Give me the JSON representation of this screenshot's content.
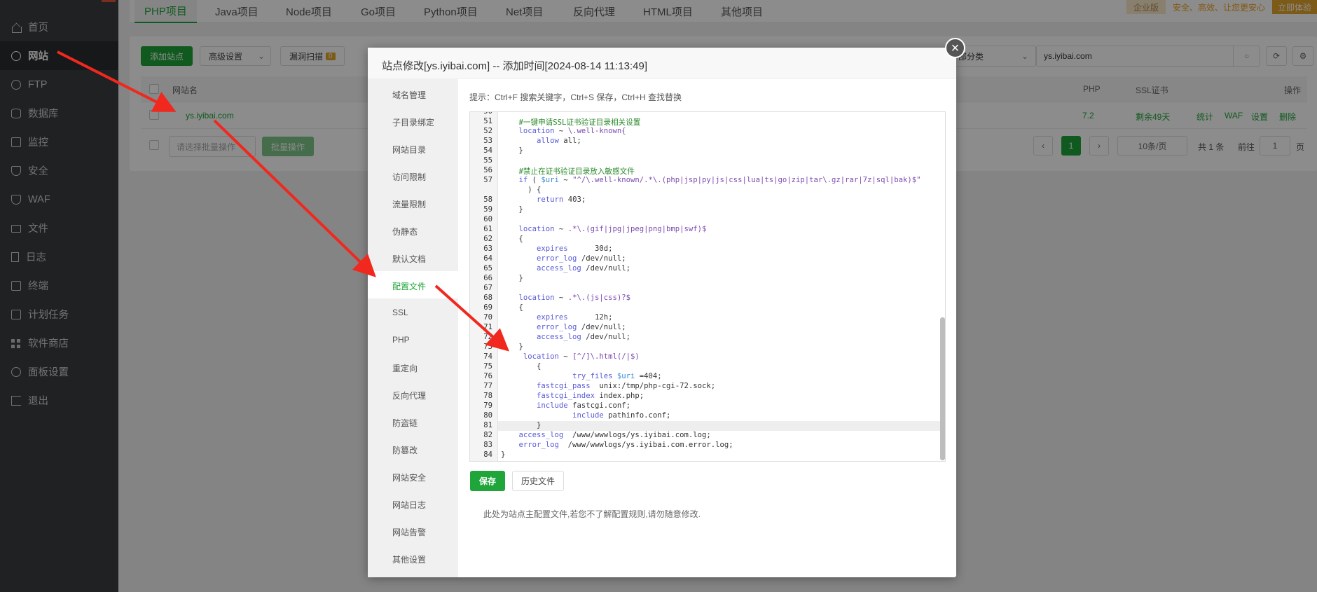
{
  "sidebar": {
    "items": [
      {
        "label": "首页",
        "icon": "home-icon"
      },
      {
        "label": "网站",
        "icon": "globe-icon",
        "active": true
      },
      {
        "label": "FTP",
        "icon": "ftp-icon"
      },
      {
        "label": "数据库",
        "icon": "database-icon"
      },
      {
        "label": "监控",
        "icon": "monitor-icon"
      },
      {
        "label": "安全",
        "icon": "shield-icon"
      },
      {
        "label": "WAF",
        "icon": "waf-icon"
      },
      {
        "label": "文件",
        "icon": "folder-icon"
      },
      {
        "label": "日志",
        "icon": "log-icon"
      },
      {
        "label": "终端",
        "icon": "terminal-icon"
      },
      {
        "label": "计划任务",
        "icon": "calendar-icon"
      },
      {
        "label": "软件商店",
        "icon": "grid-icon"
      },
      {
        "label": "面板设置",
        "icon": "gear-icon"
      },
      {
        "label": "退出",
        "icon": "exit-icon"
      }
    ]
  },
  "project_tabs": [
    "PHP项目",
    "Java项目",
    "Node项目",
    "Go项目",
    "Python项目",
    "Net项目",
    "反向代理",
    "HTML项目",
    "其他项目"
  ],
  "promo": {
    "edition": "企业版",
    "slogan": "安全、高效、让您更安心",
    "cta": "立即体验"
  },
  "toolbar": {
    "add_site": "添加站点",
    "advanced": "高级设置",
    "vuln_scan": "漏洞扫描",
    "vuln_count": "0",
    "category_select": "部分类",
    "search_value": "ys.iyibai.com"
  },
  "table": {
    "headers": {
      "name": "网站名",
      "php": "PHP",
      "ssl": "SSL证书",
      "ops": "操作"
    },
    "row": {
      "name": "ys.iyibai.com",
      "php": "7.2",
      "ssl": "剩余49天",
      "ops": [
        "统计",
        "WAF",
        "设置",
        "删除"
      ]
    },
    "batch_placeholder": "请选择批量操作",
    "batch_button": "批量操作"
  },
  "pagination": {
    "prev": "‹",
    "current": "1",
    "next": "›",
    "per_page": "10条/页",
    "total": "共 1 条",
    "goto_label": "前往",
    "goto_value": "1",
    "page_suffix": "页"
  },
  "modal": {
    "title": "站点修改[ys.iyibai.com] -- 添加时间[2024-08-14 11:13:49]",
    "close": "×",
    "menu": [
      "域名管理",
      "子目录绑定",
      "网站目录",
      "访问限制",
      "流量限制",
      "伪静态",
      "默认文档",
      "配置文件",
      "SSL",
      "PHP",
      "重定向",
      "反向代理",
      "防盗链",
      "防篡改",
      "网站安全",
      "网站日志",
      "网站告警",
      "其他设置"
    ],
    "active_menu": "配置文件",
    "tip": "提示：Ctrl+F 搜索关键字，Ctrl+S 保存，Ctrl+H 查找替换",
    "editor_lines": [
      {
        "n": "50",
        "t": ""
      },
      {
        "n": "51",
        "t": "    #一键申请SSL证书验证目录相关设置"
      },
      {
        "n": "52",
        "t": "    location ~ \\.well-known{"
      },
      {
        "n": "53",
        "t": "        allow all;"
      },
      {
        "n": "54",
        "t": "    }"
      },
      {
        "n": "55",
        "t": ""
      },
      {
        "n": "56",
        "t": "    #禁止在证书验证目录放入敏感文件"
      },
      {
        "n": "57",
        "t": "    if ( $uri ~ \"^/\\.well-known/.*\\.(php|jsp|py|js|css|lua|ts|go|zip|tar\\.gz|rar|7z|sql|bak)$\""
      },
      {
        "n": "",
        "t": "      ) {"
      },
      {
        "n": "58",
        "t": "        return 403;"
      },
      {
        "n": "59",
        "t": "    }"
      },
      {
        "n": "60",
        "t": ""
      },
      {
        "n": "61",
        "t": "    location ~ .*\\.(gif|jpg|jpeg|png|bmp|swf)$"
      },
      {
        "n": "62",
        "t": "    {"
      },
      {
        "n": "63",
        "t": "        expires      30d;"
      },
      {
        "n": "64",
        "t": "        error_log /dev/null;"
      },
      {
        "n": "65",
        "t": "        access_log /dev/null;"
      },
      {
        "n": "66",
        "t": "    }"
      },
      {
        "n": "67",
        "t": ""
      },
      {
        "n": "68",
        "t": "    location ~ .*\\.(js|css)?$"
      },
      {
        "n": "69",
        "t": "    {"
      },
      {
        "n": "70",
        "t": "        expires      12h;"
      },
      {
        "n": "71",
        "t": "        error_log /dev/null;"
      },
      {
        "n": "72",
        "t": "        access_log /dev/null;"
      },
      {
        "n": "73",
        "t": "    }"
      },
      {
        "n": "74",
        "t": "     location ~ [^/]\\.html(/|$)"
      },
      {
        "n": "75",
        "t": "        {"
      },
      {
        "n": "76",
        "t": "                try_files $uri =404;"
      },
      {
        "n": "77",
        "t": "        fastcgi_pass  unix:/tmp/php-cgi-72.sock;"
      },
      {
        "n": "78",
        "t": "        fastcgi_index index.php;"
      },
      {
        "n": "79",
        "t": "        include fastcgi.conf;"
      },
      {
        "n": "80",
        "t": "                include pathinfo.conf;"
      },
      {
        "n": "81",
        "t": "        }"
      },
      {
        "n": "82",
        "t": "    access_log  /www/wwwlogs/ys.iyibai.com.log;"
      },
      {
        "n": "83",
        "t": "    error_log  /www/wwwlogs/ys.iyibai.com.error.log;"
      },
      {
        "n": "84",
        "t": "}"
      }
    ],
    "save": "保存",
    "history": "历史文件",
    "note": "此处为站点主配置文件,若您不了解配置规则,请勿随意修改."
  },
  "colors": {
    "accent": "#20a53a",
    "sidebar": "#3a3d40",
    "arrow": "#f0281e"
  }
}
